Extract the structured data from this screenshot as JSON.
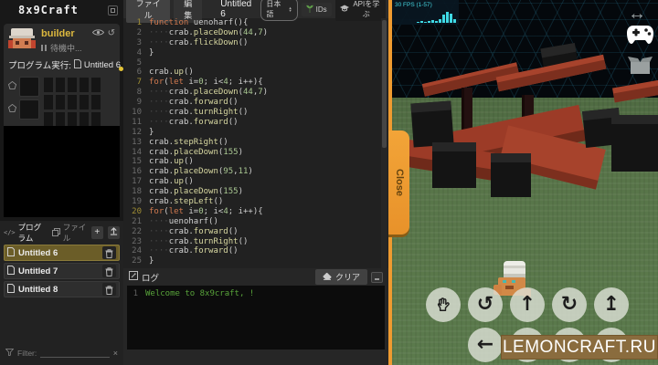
{
  "app": {
    "logo": "8x9Craft"
  },
  "colors": {
    "accent": "#ef9b30",
    "selection": "#6b5d28",
    "log_green": "#58a33a",
    "fps_cyan": "#45d5e0"
  },
  "sidebar": {
    "robot": {
      "name": "builder",
      "status": "待機中...",
      "run_label": "プログラム実行:",
      "run_target": "Untitled 6"
    },
    "programs": {
      "tab_program": "プログラム",
      "tab_file": "ファイル",
      "add_label": "+",
      "filter_label": "Filter:",
      "clear_filter": "×",
      "items": [
        {
          "name": "Untitled 6",
          "selected": true
        },
        {
          "name": "Untitled 7",
          "selected": false
        },
        {
          "name": "Untitled 8",
          "selected": false
        }
      ]
    }
  },
  "editor": {
    "menu": {
      "file": "ファイル",
      "edit": "編集",
      "title": "Untitled 6",
      "language": "日本語",
      "ids": "IDs",
      "learn_api": "APIを学ぶ"
    },
    "highlight_lines": [
      1,
      7,
      20
    ],
    "code": [
      "function uenoharf(){",
      "    crab.placeDown(44,7)",
      "    crab.flickDown()",
      "}",
      "",
      "crab.up()",
      "for(let i=0; i<4; i++){",
      "    crab.placeDown(44,7)",
      "    crab.forward()",
      "    crab.turnRight()",
      "    crab.forward()",
      "}",
      "crab.stepRight()",
      "crab.placeDown(155)",
      "crab.up()",
      "crab.placeDown(95,11)",
      "crab.up()",
      "crab.placeDown(155)",
      "crab.stepLeft()",
      "for(let i=0; i<4; i++){",
      "    uenoharf()",
      "    crab.forward()",
      "    crab.turnRight()",
      "    crab.forward()",
      "}"
    ]
  },
  "log": {
    "title": "ログ",
    "clear_label": "クリア",
    "entries": [
      {
        "num": "1",
        "text": "Welcome to 8x9craft, !"
      }
    ]
  },
  "game": {
    "fps": "30 FPS (1-57)",
    "fps_bars": [
      1,
      2,
      1,
      2,
      3,
      2,
      4,
      9,
      12,
      10,
      4
    ],
    "close_label": "Close",
    "watermark": "LEMONCRAFT.RU",
    "resize_icon": "↔",
    "controls_row1": [
      {
        "name": "grab-hand",
        "glyph": ""
      },
      {
        "name": "rotate-left",
        "glyph": "↺"
      },
      {
        "name": "forward",
        "glyph": "↑"
      },
      {
        "name": "rotate-right",
        "glyph": "↻"
      },
      {
        "name": "up",
        "glyph": "↥"
      }
    ],
    "controls_row2": [
      {
        "name": "step-left",
        "glyph": "←"
      },
      {
        "name": "back",
        "glyph": "↓"
      },
      {
        "name": "step-right",
        "glyph": "→"
      },
      {
        "name": "down",
        "glyph": "↧"
      }
    ]
  }
}
